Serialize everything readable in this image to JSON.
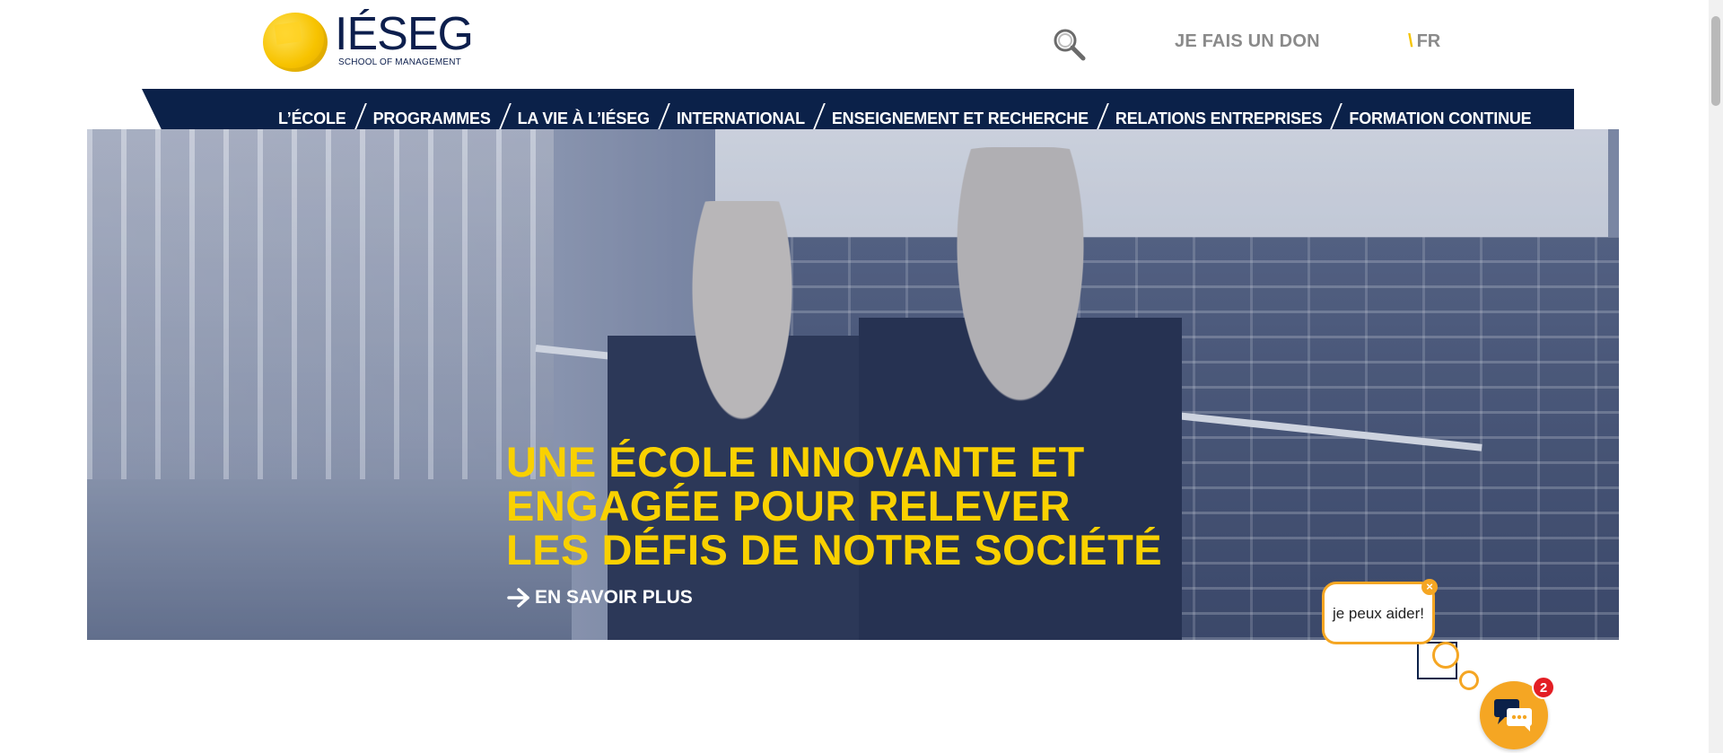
{
  "header": {
    "logo": {
      "name": "IÉSEG",
      "subtitle": "SCHOOL OF MANAGEMENT"
    },
    "donate_label": "JE FAIS UN DON",
    "language": {
      "separator": "\\",
      "current": "FR"
    }
  },
  "nav": {
    "items": [
      {
        "label": "L’ÉCOLE"
      },
      {
        "label": "PROGRAMMES"
      },
      {
        "label": "LA VIE À L’IÉSEG"
      },
      {
        "label": "INTERNATIONAL"
      },
      {
        "label": "ENSEIGNEMENT ET RECHERCHE"
      },
      {
        "label": "RELATIONS ENTREPRISES"
      },
      {
        "label": "FORMATION CONTINUE"
      }
    ]
  },
  "hero": {
    "headline": [
      "UNE ÉCOLE INNOVANTE ET",
      "ENGAGÉE POUR RELEVER",
      "LES DÉFIS DE NOTRE SOCIÉTÉ"
    ],
    "cta_label": "EN SAVOIR PLUS"
  },
  "chat": {
    "bubble_text": "je peux aider!",
    "close_glyph": "×",
    "badge_count": "2"
  },
  "colors": {
    "navy": "#0b2149",
    "yellow": "#f9d100",
    "orange": "#f5a623",
    "badge_red": "#e31e24",
    "grey_text": "#8a8a8a"
  },
  "icons": [
    "search-icon",
    "arrow-right-icon",
    "chat-icon",
    "close-icon"
  ]
}
